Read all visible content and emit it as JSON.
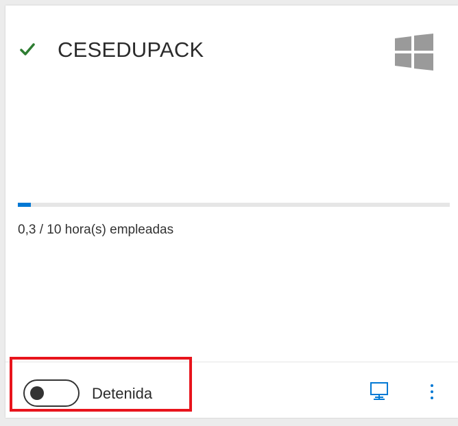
{
  "card": {
    "name": "CESEDUPACK",
    "status_icon": "check-icon",
    "os_icon": "windows-logo-icon",
    "usage": {
      "used": 0.3,
      "total": 10,
      "text": "0,3 / 10 hora(s) empleadas"
    },
    "toggle": {
      "state": "off",
      "label": "Detenida"
    },
    "actions": {
      "connect_icon": "monitor-icon",
      "more_icon": "more-vertical-icon"
    }
  },
  "colors": {
    "accent": "#0078d4",
    "check": "#2e7d32",
    "highlight": "#e8141c",
    "os_icon": "#9a9a9a",
    "action_icon": "#0078d4"
  }
}
